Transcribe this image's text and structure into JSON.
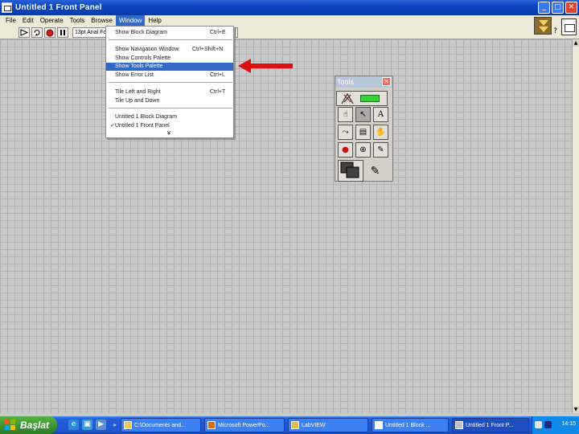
{
  "window": {
    "title": "Untitled 1 Front Panel",
    "controls": {
      "minimize": "_",
      "maximize": "□",
      "close": "✕"
    }
  },
  "menubar": {
    "items": [
      "File",
      "Edit",
      "Operate",
      "Tools",
      "Browse",
      "Window",
      "Help"
    ],
    "active": "Window"
  },
  "toolbar": {
    "run_icon": "run-arrow-icon",
    "run_continuous_icon": "run-continuously-icon",
    "abort_icon": "abort-icon",
    "pause_icon": "pause-icon",
    "font_select": "13pt Arial Font",
    "help_label": "?"
  },
  "window_menu": {
    "items": [
      {
        "label": "Show Block Diagram",
        "shortcut": "Ctrl+E"
      },
      {
        "label": "Show Navigation Window",
        "shortcut": "Ctrl+Shift+N"
      },
      {
        "label": "Show Controls Palette",
        "shortcut": ""
      },
      {
        "label": "Show Tools Palette",
        "shortcut": "",
        "highlighted": true
      },
      {
        "label": "Show Error List",
        "shortcut": "Ctrl+L"
      },
      {
        "label": "Tile Left and Right",
        "shortcut": "Ctrl+T"
      },
      {
        "label": "Tile Up and Down",
        "shortcut": ""
      },
      {
        "label": "Untitled 1 Block Diagram",
        "shortcut": ""
      },
      {
        "label": "Untitled 1 Front Panel",
        "shortcut": "",
        "checked": true
      }
    ],
    "check_mark": "✓",
    "more_marker": "¥"
  },
  "tools_palette": {
    "title": "Tools",
    "close": "✕",
    "tools": [
      {
        "icon": "operate-value-icon",
        "glyph": "☝"
      },
      {
        "icon": "position-select-icon",
        "glyph": "↖"
      },
      {
        "icon": "edit-text-icon",
        "glyph": "A"
      },
      {
        "icon": "connect-wire-icon",
        "glyph": "⤳"
      },
      {
        "icon": "object-shortcut-menu-icon",
        "glyph": "▤"
      },
      {
        "icon": "scroll-window-icon",
        "glyph": "✋"
      },
      {
        "icon": "set-clear-breakpoint-icon",
        "glyph": "●"
      },
      {
        "icon": "probe-data-icon",
        "glyph": "⊕"
      },
      {
        "icon": "get-color-icon",
        "glyph": "✎"
      }
    ],
    "auto_tool_icon": "automatic-tool-selection-icon",
    "color_tool_icon": "set-color-icon",
    "color_tool_brush_glyph": "✎"
  },
  "taskbar": {
    "start_label": "Başlat",
    "tasks": [
      {
        "label": "C:\\Documents and...",
        "icon": "folder-icon"
      },
      {
        "label": "Microsoft PowerPo...",
        "icon": "powerpoint-icon"
      },
      {
        "label": "LabVIEW",
        "icon": "labview-icon"
      },
      {
        "label": "Untitled 1 Block ...",
        "icon": "block-diagram-icon"
      },
      {
        "label": "Untitled 1 Front P...",
        "icon": "front-panel-icon",
        "active": true
      }
    ],
    "clock": "14:15"
  },
  "colors": {
    "titlebar": "#0b45c0",
    "highlight": "#316ac5",
    "arrow": "#e01010",
    "canvas": "#c9c9c9",
    "led_green": "#33d633"
  }
}
